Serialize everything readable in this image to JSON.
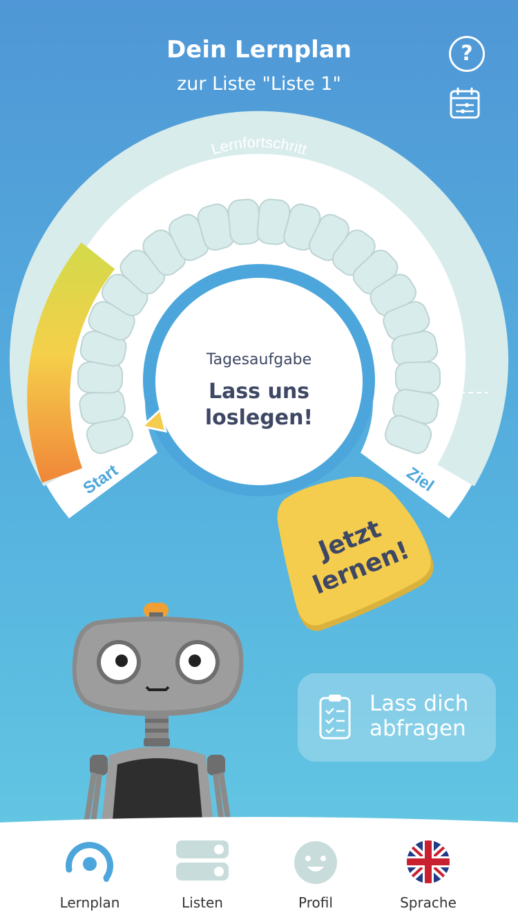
{
  "header": {
    "title": "Dein Lernplan",
    "subtitle": "zur Liste \"Liste 1\"",
    "help_icon": "help-icon",
    "calendar_icon": "calendar-icon"
  },
  "gauge": {
    "label": "Lernfortschritt",
    "start_label": "Start",
    "goal_label": "Ziel",
    "progress": 0.22,
    "segments": 22,
    "colors": {
      "track": "#d9ecec",
      "progress_top": "#d6d94a",
      "progress_bottom": "#f08a3a",
      "inner_ring": "#4ca6db"
    }
  },
  "daily_task": {
    "label": "Tagesaufgabe",
    "message": "Lass uns loslegen!"
  },
  "learn_button": {
    "label": "Jetzt lernen!",
    "color": "#f5cd4e"
  },
  "quiz_button": {
    "label": "Lass dich abfragen",
    "icon": "clipboard-checklist-icon"
  },
  "mascot": {
    "icon": "robot-mascot"
  },
  "tabs": [
    {
      "label": "Lernplan",
      "icon": "progress-ring-icon",
      "active": true
    },
    {
      "label": "Listen",
      "icon": "lists-icon",
      "active": false
    },
    {
      "label": "Profil",
      "icon": "smiley-face-icon",
      "active": false
    },
    {
      "label": "Sprache",
      "icon": "uk-flag-icon",
      "active": false
    }
  ]
}
